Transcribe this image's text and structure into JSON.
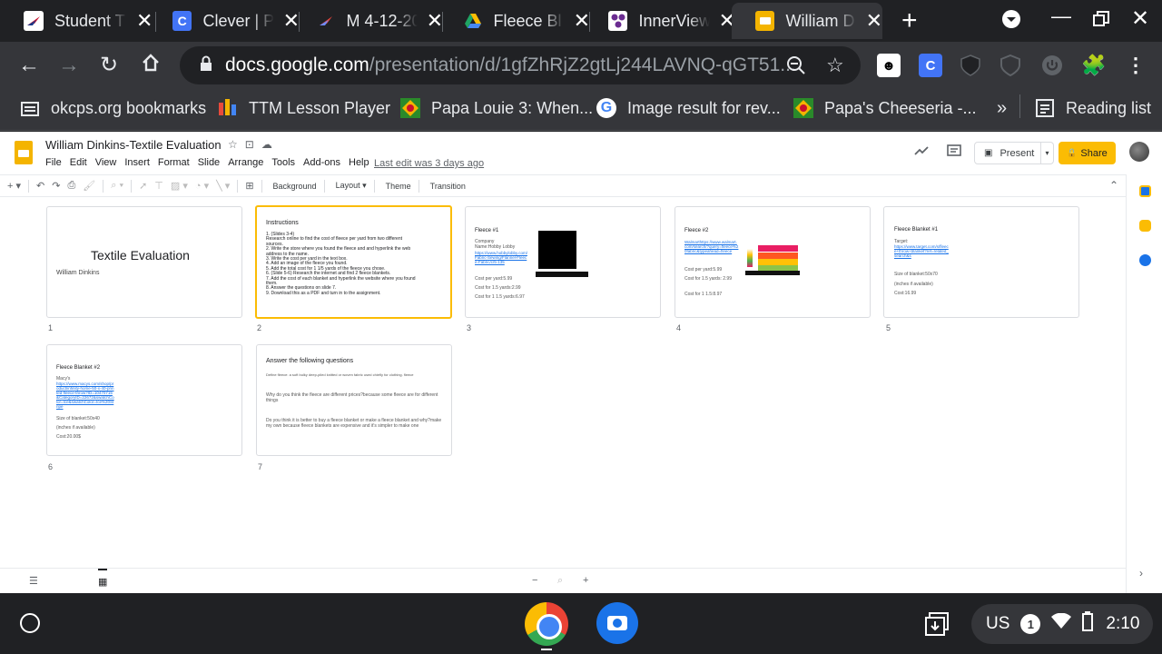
{
  "tabs": [
    {
      "title": "Student T",
      "icon": "bird-logo-icon",
      "active": false
    },
    {
      "title": "Clever | P",
      "icon": "clever-icon",
      "active": false
    },
    {
      "title": "M 4-12-20",
      "icon": "bird-logo-icon",
      "active": false
    },
    {
      "title": "Fleece Bl",
      "icon": "drive-icon",
      "active": false
    },
    {
      "title": "InnerView",
      "icon": "innerview-icon",
      "active": false
    },
    {
      "title": "William D",
      "icon": "slides-icon",
      "active": true
    }
  ],
  "omnibox": {
    "domain": "docs.google.com",
    "path": "/presentation/d/1gfZhRjZ2gtLj244LAVNQ-qGT51..."
  },
  "bookmarks": [
    {
      "label": "okcps.org bookmarks",
      "icon": "folder-icon"
    },
    {
      "label": "TTM Lesson Player",
      "icon": "ttm-icon"
    },
    {
      "label": "Papa Louie 3: When...",
      "icon": "papa-icon"
    },
    {
      "label": "Image result for rev...",
      "icon": "google-icon"
    },
    {
      "label": "Papa's Cheeseria -...",
      "icon": "papa-icon"
    }
  ],
  "bookmarks_overflow": "»",
  "reading_list": "Reading list",
  "doc": {
    "title": "William Dinkins-Textile Evaluation",
    "menu": [
      "File",
      "Edit",
      "View",
      "Insert",
      "Format",
      "Slide",
      "Arrange",
      "Tools",
      "Add-ons",
      "Help"
    ],
    "last_edit": "Last edit was 3 days ago",
    "present": "Present",
    "share": "Share"
  },
  "toolbar": {
    "background": "Background",
    "layout": "Layout",
    "theme": "Theme",
    "transition": "Transition"
  },
  "slides": {
    "s1": {
      "num": "1",
      "title": "Textile Evaluation",
      "subtitle": "William Dinkins"
    },
    "s2": {
      "num": "2",
      "title": "Instructions",
      "items": [
        "1.   (Slides 3-4)",
        "       Research online to find the cost of fleece per yard from two different",
        "       sources.",
        "2.   Write the store where you found the fleece and and hyperlink the web",
        "       address to the name.",
        "3.   Write the cost per yard in the text box.",
        "4.   Add an image of the fleece you found.",
        "5.   Add the total cost for 1 1/5 yards of the fleece you chose.",
        "6.   (Slide 5-6) Research the internet and find 2 fleece blankets.",
        "7.   Add the cost of each blanket and hyperlink the website where you found",
        "       them.",
        "8.   Answer the questions on slide 7.",
        "9.   Download this as a PDF and turn in to the assignment."
      ]
    },
    "s3": {
      "num": "3",
      "title": "Fleece #1",
      "company": "Company Name:Hobby Lobby",
      "link": "https://www.hobbylobby.com/Fabric-Sewing/Flannel-Fleece-Fabric/c/5-135",
      "cost_yard": "Cost per yard:5.99",
      "cost_15": "Cost for 1.5 yards:2.99",
      "cost_115": "Cost for 1 1.5 yards:6.97"
    },
    "s4": {
      "num": "4",
      "title": "Fleece #2",
      "link": "Walmarthttps://www.walmart.com/search/?query=fleece%20fabric&typeahead=fleece",
      "cost_yard": "Cost per yard:5.99",
      "cost_15": "Cost for 1.5 yards: 2.99",
      "cost_115": "Cost for 1 1.5:8.97"
    },
    "s5": {
      "num": "5",
      "title": "Fleece Blanket #1",
      "store": "Target:",
      "link": "https://www.target.com/s/fleece+throw+blanket?ref=related_search&s",
      "size": "Size of blanket:50x70",
      "inches": "(inches if available)",
      "cost": "Cost:16.99"
    },
    "s6": {
      "num": "6",
      "title": "Fleece Blanket #2",
      "store": "Macy's",
      "link": "https://www.macys.com/shop/product/infinity-home-50-x-40-printed-fleece-throw?ID=10470715&CategoryID=22672&swatchColor=Ice&swatchColor=Ice%20Stripe",
      "size": "Size of blanket:50x40",
      "inches": "(inches if available)",
      "cost": "Cost:20.00$"
    },
    "s7": {
      "num": "7",
      "title": "Answer the following questions",
      "q1": "Define fleece: a soft bulky deep-piled knitted or woven fabric used chiefly for clothing. fleece",
      "q2": "Why do you think the fleece are different prices?because some fleece are for different things",
      "q3": "Do you think it is better to buy a fleece blanket or make a fleece blanket and why?make my own because fleece blankets are expensive and it's simpler to make one"
    }
  },
  "tray": {
    "ime": "US",
    "notif": "1",
    "time": "2:10"
  }
}
